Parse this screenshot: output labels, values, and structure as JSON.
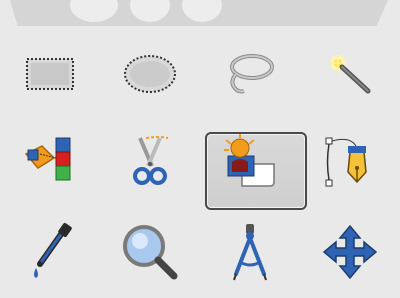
{
  "toolbox": {
    "tools": [
      {
        "name": "rectangle-select",
        "icon": "rectangle-select-icon",
        "active": false
      },
      {
        "name": "ellipse-select",
        "icon": "ellipse-select-icon",
        "active": false
      },
      {
        "name": "free-select",
        "icon": "lasso-icon",
        "active": false
      },
      {
        "name": "fuzzy-select",
        "icon": "magic-wand-icon",
        "active": false
      },
      {
        "name": "select-by-color",
        "icon": "select-by-color-icon",
        "active": false
      },
      {
        "name": "scissors-select",
        "icon": "scissors-icon",
        "active": false
      },
      {
        "name": "foreground-select",
        "icon": "foreground-select-icon",
        "active": true
      },
      {
        "name": "paths",
        "icon": "paths-pen-icon",
        "active": false
      },
      {
        "name": "color-picker",
        "icon": "eyedropper-icon",
        "active": false
      },
      {
        "name": "zoom",
        "icon": "magnifier-icon",
        "active": false
      },
      {
        "name": "measure",
        "icon": "compass-icon",
        "active": false
      },
      {
        "name": "move",
        "icon": "move-arrows-icon",
        "active": false
      }
    ]
  },
  "colors": {
    "background": "#e9e9e9",
    "active_border": "#4a4a4a",
    "accent_blue": "#2f63b3",
    "accent_orange": "#f39c1b"
  }
}
